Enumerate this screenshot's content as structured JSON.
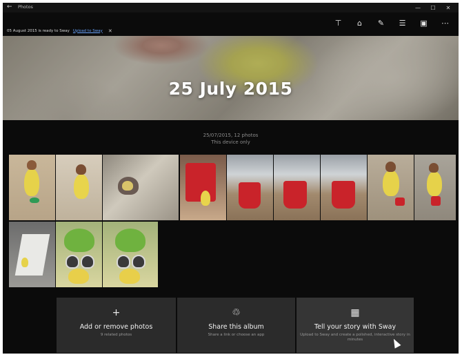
{
  "window": {
    "title": "Photos",
    "back_glyph": "←",
    "controls": {
      "minimize": "—",
      "maximize": "☐",
      "close": "✕"
    }
  },
  "command_bar": [
    {
      "name": "pin-icon",
      "glyph": "⊤"
    },
    {
      "name": "share-icon",
      "glyph": "⌂"
    },
    {
      "name": "edit-icon",
      "glyph": "✎"
    },
    {
      "name": "select-icon",
      "glyph": "☰"
    },
    {
      "name": "slideshow-icon",
      "glyph": "▣"
    },
    {
      "name": "more-icon",
      "glyph": "⋯"
    }
  ],
  "banner": {
    "text": "05 August 2015 is ready to Sway",
    "link": "Upload to Sway",
    "close": "✕"
  },
  "hero": {
    "title": "25 July 2015"
  },
  "info": {
    "line1": "25/07/2015, 12 photos",
    "line2": "This device only"
  },
  "colors": {
    "background": "#0b0b0b",
    "tile": "#2b2b2b",
    "link": "#6aa5ff"
  },
  "tiles": [
    {
      "icon": "+",
      "title": "Add or remove photos",
      "sub": "9 related photos"
    },
    {
      "icon": "♲",
      "title": "Share this album",
      "sub": "Share a link or choose an app"
    },
    {
      "icon": "▦",
      "title": "Tell your story with Sway",
      "sub": "Upload to Sway and create a polished, interactive story in minutes"
    }
  ]
}
